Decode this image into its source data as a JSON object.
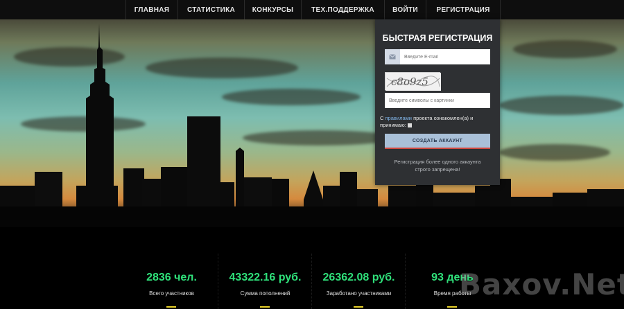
{
  "nav": {
    "items": [
      {
        "label": "ГЛАВНАЯ"
      },
      {
        "label": "СТАТИСТИКА"
      },
      {
        "label": "КОНКУРСЫ"
      },
      {
        "label": "ТЕХ.ПОДДЕРЖКА"
      },
      {
        "label": "ВОЙТИ"
      },
      {
        "label": "РЕГИСТРАЦИЯ"
      }
    ]
  },
  "registration": {
    "title": "БЫСТРАЯ РЕГИСТРАЦИЯ",
    "email_placeholder": "Введите E-mail",
    "captcha_placeholder": "Введите символы с картинки",
    "captcha_text": "c8o9z5",
    "rules_prefix": "С ",
    "rules_link": "правилами",
    "rules_suffix": " проекта ознакомлен(а) и принимаю:",
    "create_button": "СОЗДАТЬ АККАУНТ",
    "warning": "Регистрация более одного аккаунта строго запрещена!"
  },
  "stats": [
    {
      "value": "2836 чел.",
      "label": "Всего участников"
    },
    {
      "value": "43322.16 руб.",
      "label": "Сумма пополнений"
    },
    {
      "value": "26362.08 руб.",
      "label": "Заработано участниками"
    },
    {
      "value": "93 день",
      "label": "Время работы"
    }
  ],
  "watermark": "Baxov.Net",
  "colors": {
    "accent_green": "#2fe07a",
    "button_bg": "#a9c0d8",
    "button_border": "#d0473d",
    "panel_bg": "#2e3033",
    "stat_bar": "#e8d22a"
  },
  "icons": {
    "email": "envelope-icon",
    "checkbox": "checkbox-icon"
  }
}
